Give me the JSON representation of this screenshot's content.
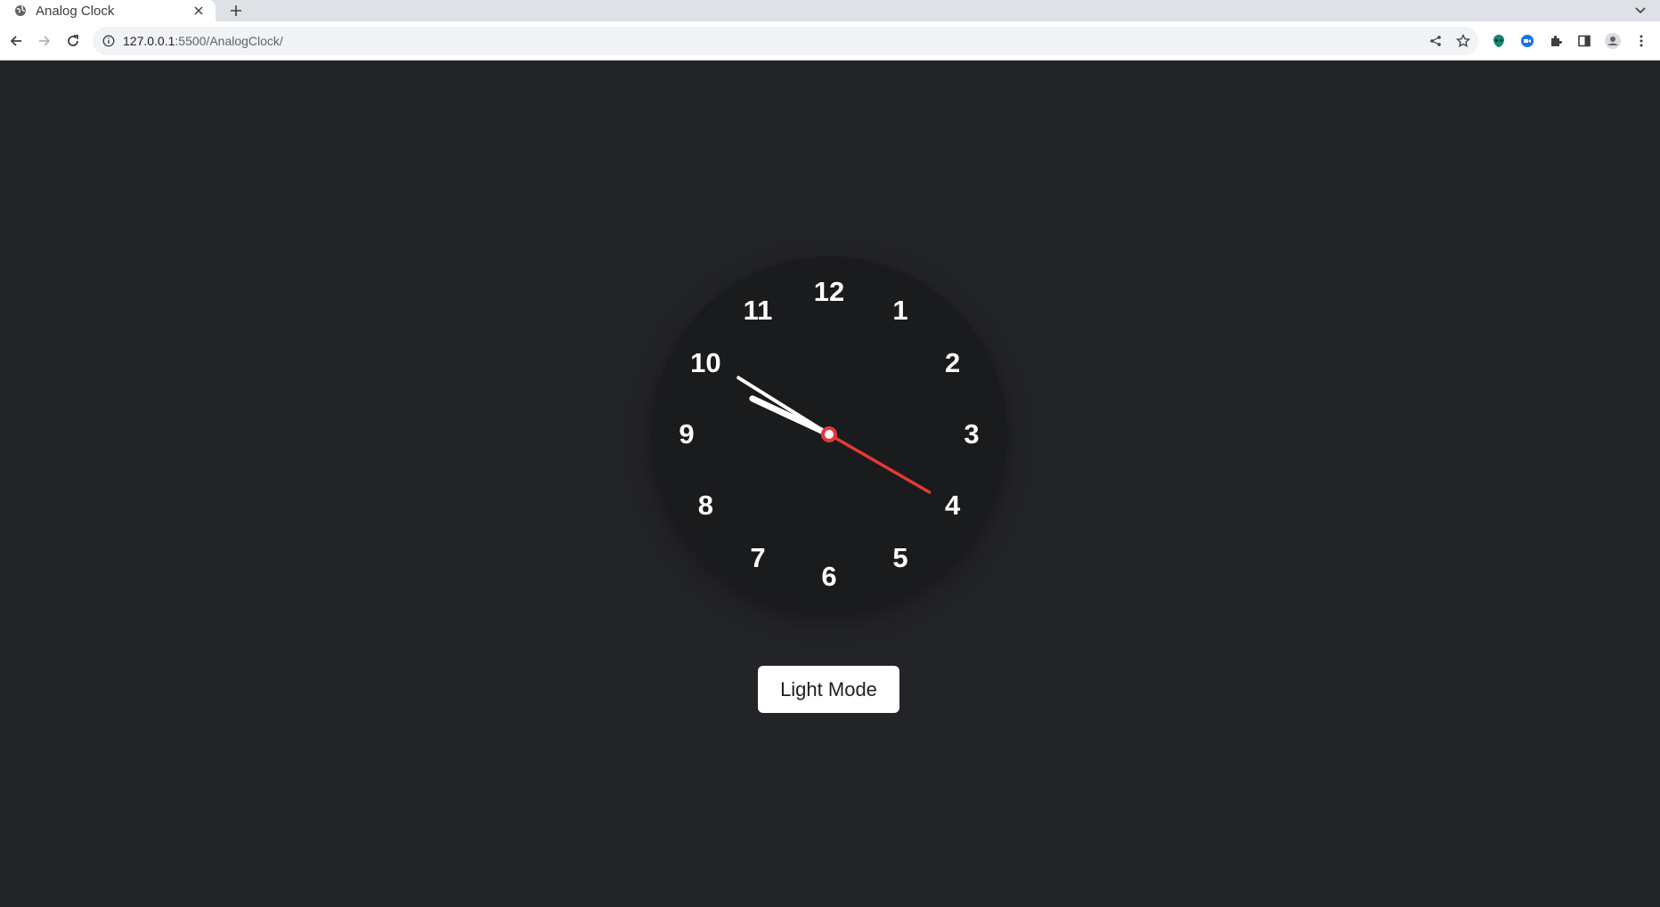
{
  "browser": {
    "tab_title": "Analog Clock",
    "url_host": "127.0.0.1",
    "url_rest": ":5500/AnalogClock/",
    "icons": {
      "favicon": "globe-icon",
      "close": "close-icon",
      "new_tab": "plus-icon",
      "tab_search": "chevron-down-icon",
      "back": "back-arrow-icon",
      "forward": "forward-arrow-icon",
      "reload": "reload-icon",
      "site_info": "info-icon",
      "share": "share-icon",
      "bookmark": "star-icon",
      "extensions": [
        "alien-extension-icon",
        "meet-extension-icon",
        "puzzle-icon",
        "side-panel-icon",
        "profile-icon",
        "kebab-menu-icon"
      ]
    }
  },
  "clock": {
    "numbers": [
      "12",
      "1",
      "2",
      "3",
      "4",
      "5",
      "6",
      "7",
      "8",
      "9",
      "10",
      "11"
    ],
    "time": {
      "hour": 9,
      "minute": 50,
      "second": 20
    },
    "colors": {
      "face": "#1a1b1d",
      "hands": "#ffffff",
      "second_hand": "#e53935",
      "numbers": "#ffffff"
    }
  },
  "mode_button": {
    "label": "Light Mode"
  },
  "colors": {
    "page_background": "#232427"
  }
}
